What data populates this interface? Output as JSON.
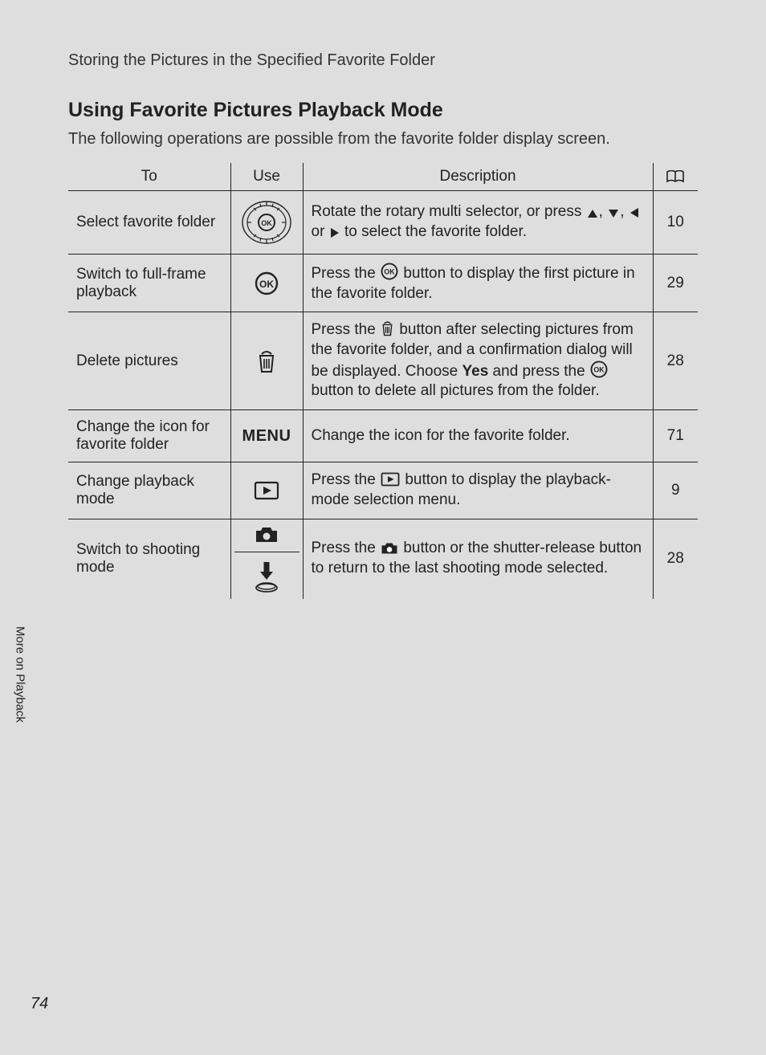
{
  "header": "Storing the Pictures in the Specified Favorite Folder",
  "heading": "Using Favorite Pictures Playback Mode",
  "intro": "The following operations are possible from the favorite folder display screen.",
  "table": {
    "headers": {
      "to": "To",
      "use": "Use",
      "description": "Description"
    },
    "rows": [
      {
        "to": "Select favorite folder",
        "desc_pre": "Rotate the rotary multi selector, or press ",
        "desc_post": " to select the favorite folder.",
        "page": "10"
      },
      {
        "to": "Switch to full-frame playback",
        "desc_pre": "Press the ",
        "desc_post": " button to display the first picture in the favorite folder.",
        "page": "29"
      },
      {
        "to": "Delete pictures",
        "desc_pre": "Press the ",
        "desc_mid1": " button after selecting pictures from the favorite folder, and a confirmation dialog will be displayed. Choose ",
        "desc_bold": "Yes",
        "desc_mid2": " and press the ",
        "desc_post": " button to delete all pictures from the folder.",
        "page": "28"
      },
      {
        "to": "Change the icon for favorite folder",
        "use_text": "MENU",
        "desc": "Change the icon for the favorite folder.",
        "page": "71"
      },
      {
        "to": "Change playback mode",
        "desc_pre": "Press the ",
        "desc_post": " button to display the playback-mode selection menu.",
        "page": "9"
      },
      {
        "to": "Switch to shooting mode",
        "desc_pre": "Press the ",
        "desc_post": " button or the shutter-release button to return to the last shooting mode selected.",
        "page": "28"
      }
    ]
  },
  "sidebar": "More on Playback",
  "page_number": "74"
}
